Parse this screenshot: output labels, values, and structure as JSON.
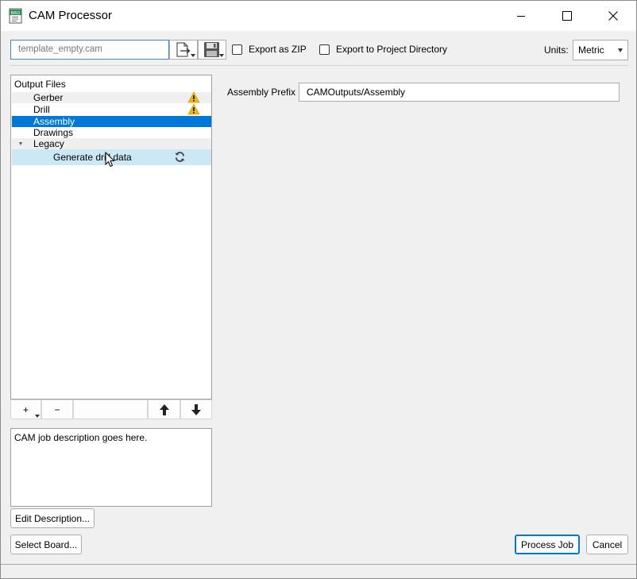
{
  "window": {
    "title": "CAM Processor",
    "icon_text": "BRD",
    "icon_color": "#2e8b57"
  },
  "toolbar": {
    "job_file": "template_empty.cam",
    "export_zip_label": "Export as ZIP",
    "export_zip_checked": false,
    "export_project_label": "Export to Project Directory",
    "export_project_checked": false,
    "units_label": "Units:",
    "units_value": "Metric"
  },
  "output_files": {
    "header": "Output Files",
    "items": [
      {
        "label": "Gerber",
        "warning": true
      },
      {
        "label": "Drill",
        "warning": true
      },
      {
        "label": "Assembly",
        "selected": true
      },
      {
        "label": "Drawings"
      },
      {
        "label": "Legacy",
        "expanded": true
      },
      {
        "label": "Generate drill data",
        "hover": true,
        "icon": "refresh-icon"
      }
    ]
  },
  "list_controls": {
    "add": "+",
    "remove": "−"
  },
  "description": {
    "text": "CAM job description goes here.",
    "edit_button": "Edit Description..."
  },
  "assembly": {
    "prefix_label": "Assembly Prefix",
    "prefix_value": "CAMOutputs/Assembly"
  },
  "buttons": {
    "select_board": "Select Board...",
    "process_job": "Process Job",
    "cancel": "Cancel"
  },
  "colors": {
    "accent": "#0078d7",
    "warning": "#f5b800",
    "hover_row": "#cce8f4"
  }
}
